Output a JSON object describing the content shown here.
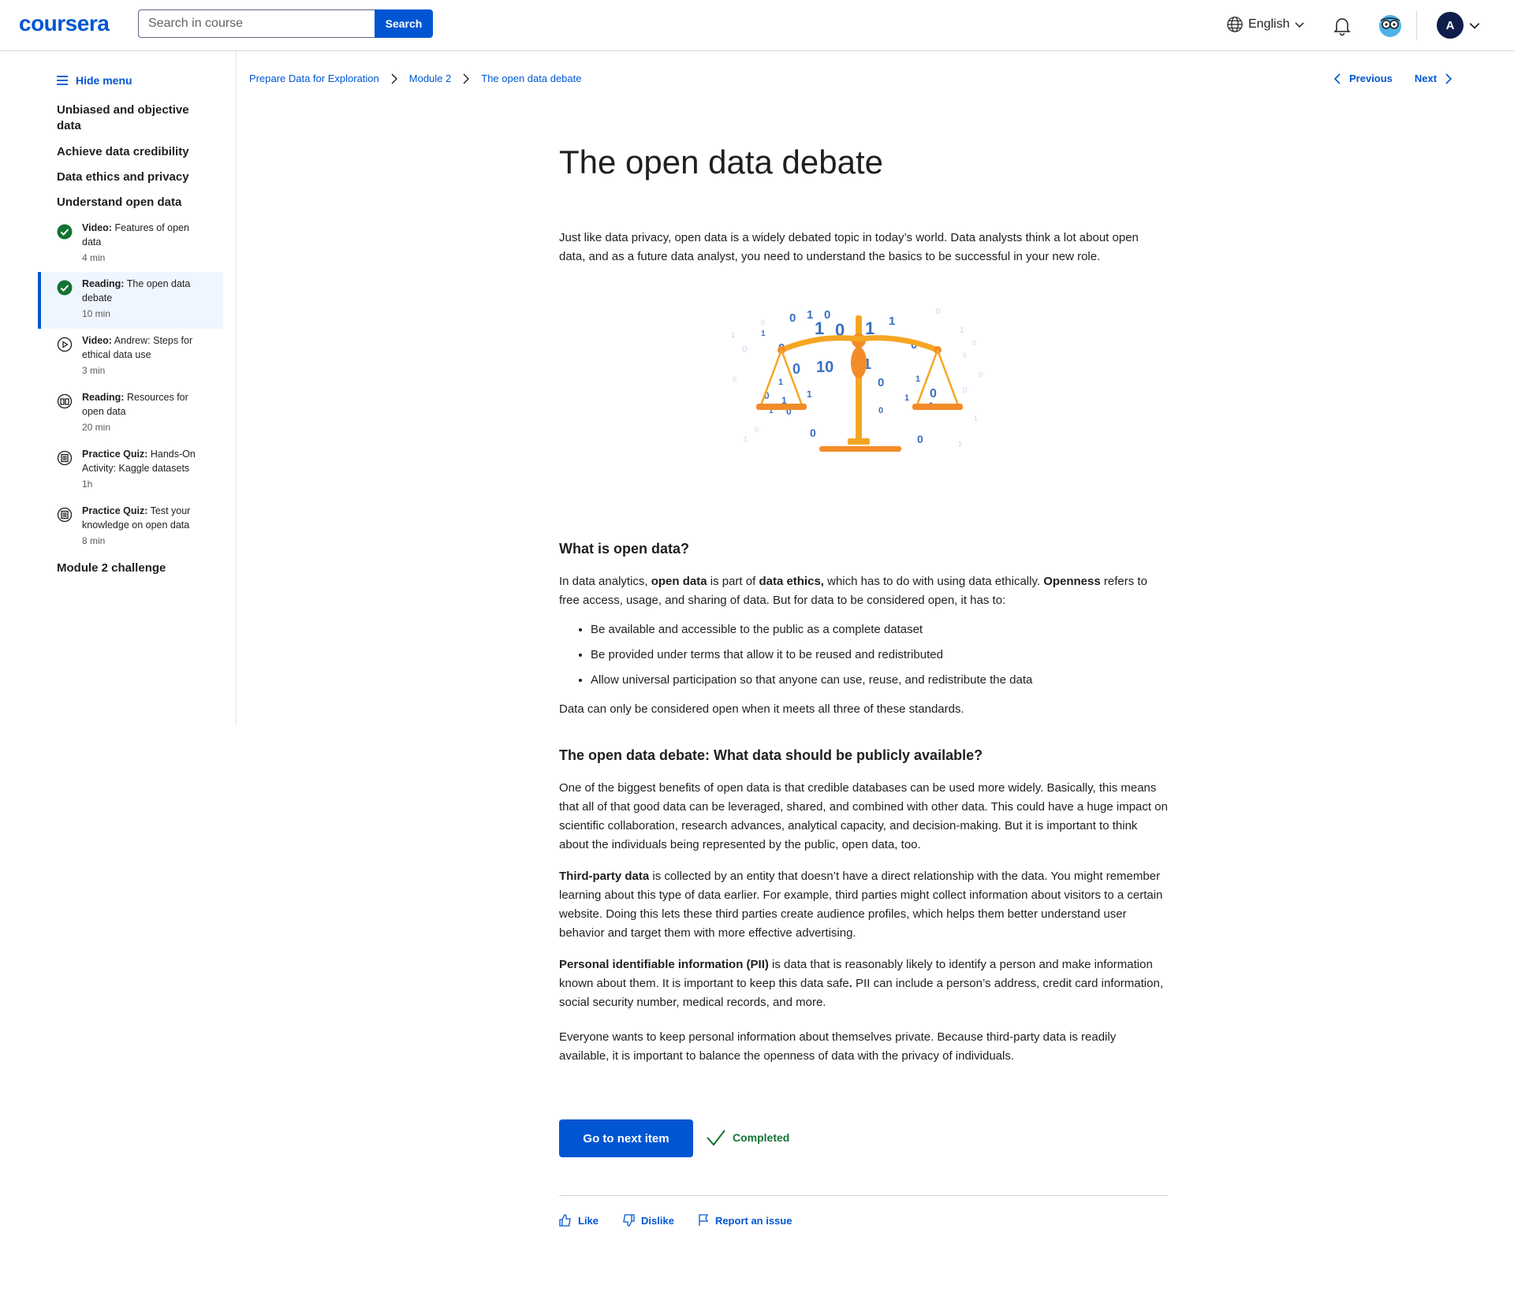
{
  "header": {
    "logo": "coursera",
    "search_placeholder": "Search in course",
    "search_button": "Search",
    "language": "English",
    "avatar_initial": "A"
  },
  "sidebar": {
    "hide_menu": "Hide menu",
    "lessons": [
      "Unbiased and objective data",
      "Achieve data credibility",
      "Data ethics and privacy",
      "Understand open data"
    ],
    "items": [
      {
        "type": "Video:",
        "title": "Features of open data",
        "duration": "4 min",
        "status": "completed",
        "icon": "check-circle-icon"
      },
      {
        "type": "Reading:",
        "title": "The open data debate",
        "duration": "10 min",
        "status": "completed-active",
        "icon": "check-circle-icon"
      },
      {
        "type": "Video:",
        "title": "Andrew: Steps for ethical data use",
        "duration": "3 min",
        "status": "todo",
        "icon": "play-circle-icon"
      },
      {
        "type": "Reading:",
        "title": "Resources for open data",
        "duration": "20 min",
        "status": "todo",
        "icon": "book-icon"
      },
      {
        "type": "Practice Quiz:",
        "title": "Hands-On Activity: Kaggle datasets",
        "duration": "1h",
        "status": "todo",
        "icon": "quiz-icon"
      },
      {
        "type": "Practice Quiz:",
        "title": "Test your knowledge on open data",
        "duration": "8 min",
        "status": "todo",
        "icon": "quiz-icon"
      }
    ],
    "module_challenge": "Module 2 challenge"
  },
  "breadcrumb": [
    "Prepare Data for Exploration",
    "Module 2",
    "The open data debate"
  ],
  "nav": {
    "previous": "Previous",
    "next": "Next"
  },
  "content": {
    "title": "The open data debate",
    "intro": "Just like data privacy, open data is a widely debated topic in today’s world. Data analysts think a lot about open data, and as a future data analyst, you need to understand the basics to be successful in your new role.",
    "section1": {
      "heading": "What is open data?",
      "p_parts": [
        "In data analytics, ",
        "open data",
        " is part of ",
        "data ethics,",
        " which has to do with using data ethically. ",
        "Openness",
        " refers to free access, usage, and sharing of data. But for data to be considered open, it has to:"
      ],
      "bullets": [
        "Be available and accessible to the public as a complete dataset",
        "Be provided under terms that allow it to be reused and redistributed",
        "Allow universal participation so that anyone can use, reuse, and redistribute the data"
      ],
      "after": "Data can only be considered open when it meets all three of these standards."
    },
    "section2": {
      "heading": "The open data debate: What data should be publicly available?",
      "p1": "One of the biggest benefits of open data is that credible databases can be used more widely. Basically, this means that all of that good data can be leveraged, shared, and combined with other data. This could have a huge impact on scientific collaboration, research advances, analytical capacity, and decision-making. But it is important to think about the individuals being represented by the public, open data, too.",
      "p2_bold": "Third-party data",
      "p2_rest": " is collected by an entity that doesn’t have a direct relationship with the data. You might remember learning about this type of data earlier. For example, third parties might collect information about visitors to a certain website. Doing this lets these third parties create audience profiles, which helps them better understand user behavior and target them with more effective advertising.",
      "p3_bold": "Personal identifiable information (PII)",
      "p3_mid": " is data that is reasonably likely to identify a person and make information known about them. It is important to keep this data safe",
      "p3_dot": ".",
      "p3_rest": " PII can include a person’s address, credit card information, social security number, medical records, and more.",
      "p4": "Everyone wants to keep personal information about themselves private. Because third-party data is readily available, it is important to balance the openness of data with the privacy of individuals."
    },
    "next_item_button": "Go to next item",
    "completed_label": "Completed"
  },
  "feedback": {
    "like": "Like",
    "dislike": "Dislike",
    "report": "Report an issue"
  },
  "colors": {
    "brand": "#0056d2",
    "completed": "#137333",
    "scale": "#f5a623"
  }
}
